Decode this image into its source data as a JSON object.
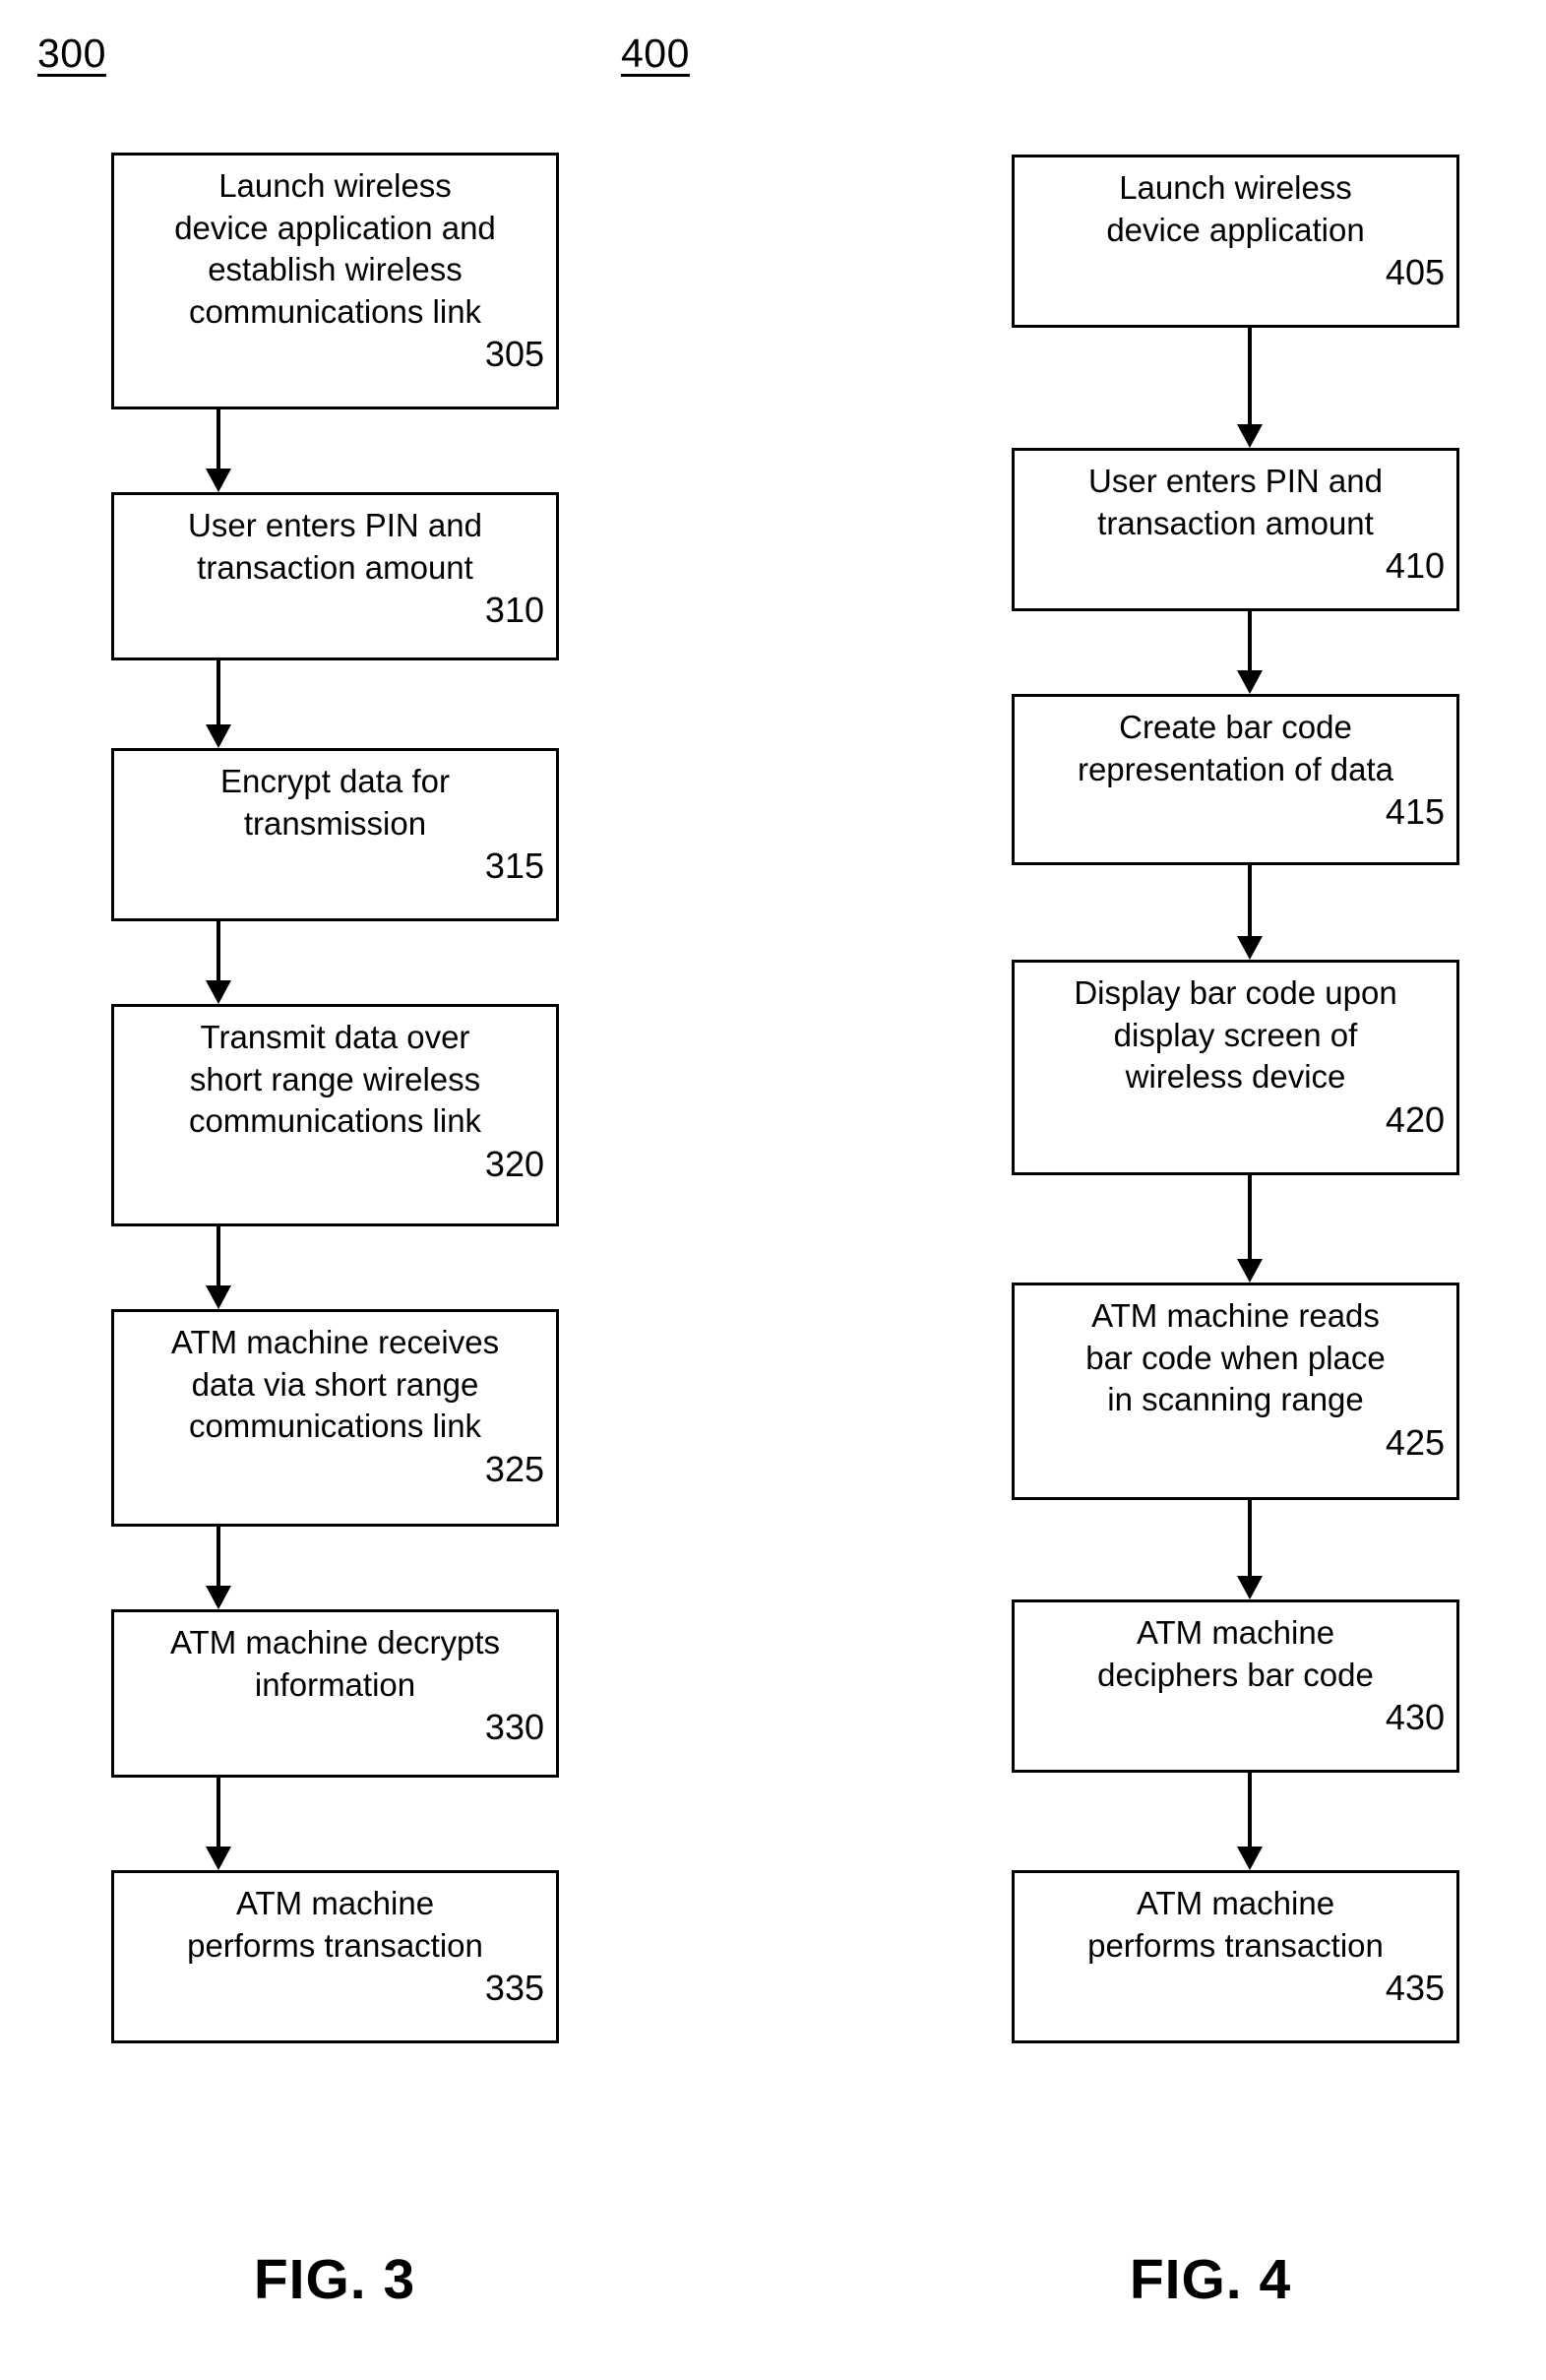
{
  "figures": [
    {
      "ref_numeral": "300",
      "caption": "FIG. 3",
      "steps": [
        {
          "text": "Launch wireless\ndevice application and\nestablish wireless\ncommunications link",
          "number": "305"
        },
        {
          "text": "User enters PIN and\ntransaction amount",
          "number": "310"
        },
        {
          "text": "Encrypt data for\ntransmission",
          "number": "315"
        },
        {
          "text": "Transmit data over\nshort range wireless\ncommunications link",
          "number": "320"
        },
        {
          "text": "ATM machine receives\ndata via short range\ncommunications link",
          "number": "325"
        },
        {
          "text": "ATM machine decrypts\ninformation",
          "number": "330"
        },
        {
          "text": "ATM machine\nperforms transaction",
          "number": "335"
        }
      ]
    },
    {
      "ref_numeral": "400",
      "caption": "FIG. 4",
      "steps": [
        {
          "text": "Launch wireless\ndevice application",
          "number": "405"
        },
        {
          "text": "User enters PIN and\ntransaction amount",
          "number": "410"
        },
        {
          "text": "Create bar code\nrepresentation of data",
          "number": "415"
        },
        {
          "text": "Display bar code upon\ndisplay screen of\nwireless device",
          "number": "420"
        },
        {
          "text": "ATM machine reads\nbar code when place\nin scanning range",
          "number": "425"
        },
        {
          "text": "ATM machine\ndeciphers bar code",
          "number": "430"
        },
        {
          "text": "ATM machine\nperforms transaction",
          "number": "435"
        }
      ]
    }
  ],
  "colors": {
    "ink": "#000000",
    "paper": "#ffffff"
  }
}
